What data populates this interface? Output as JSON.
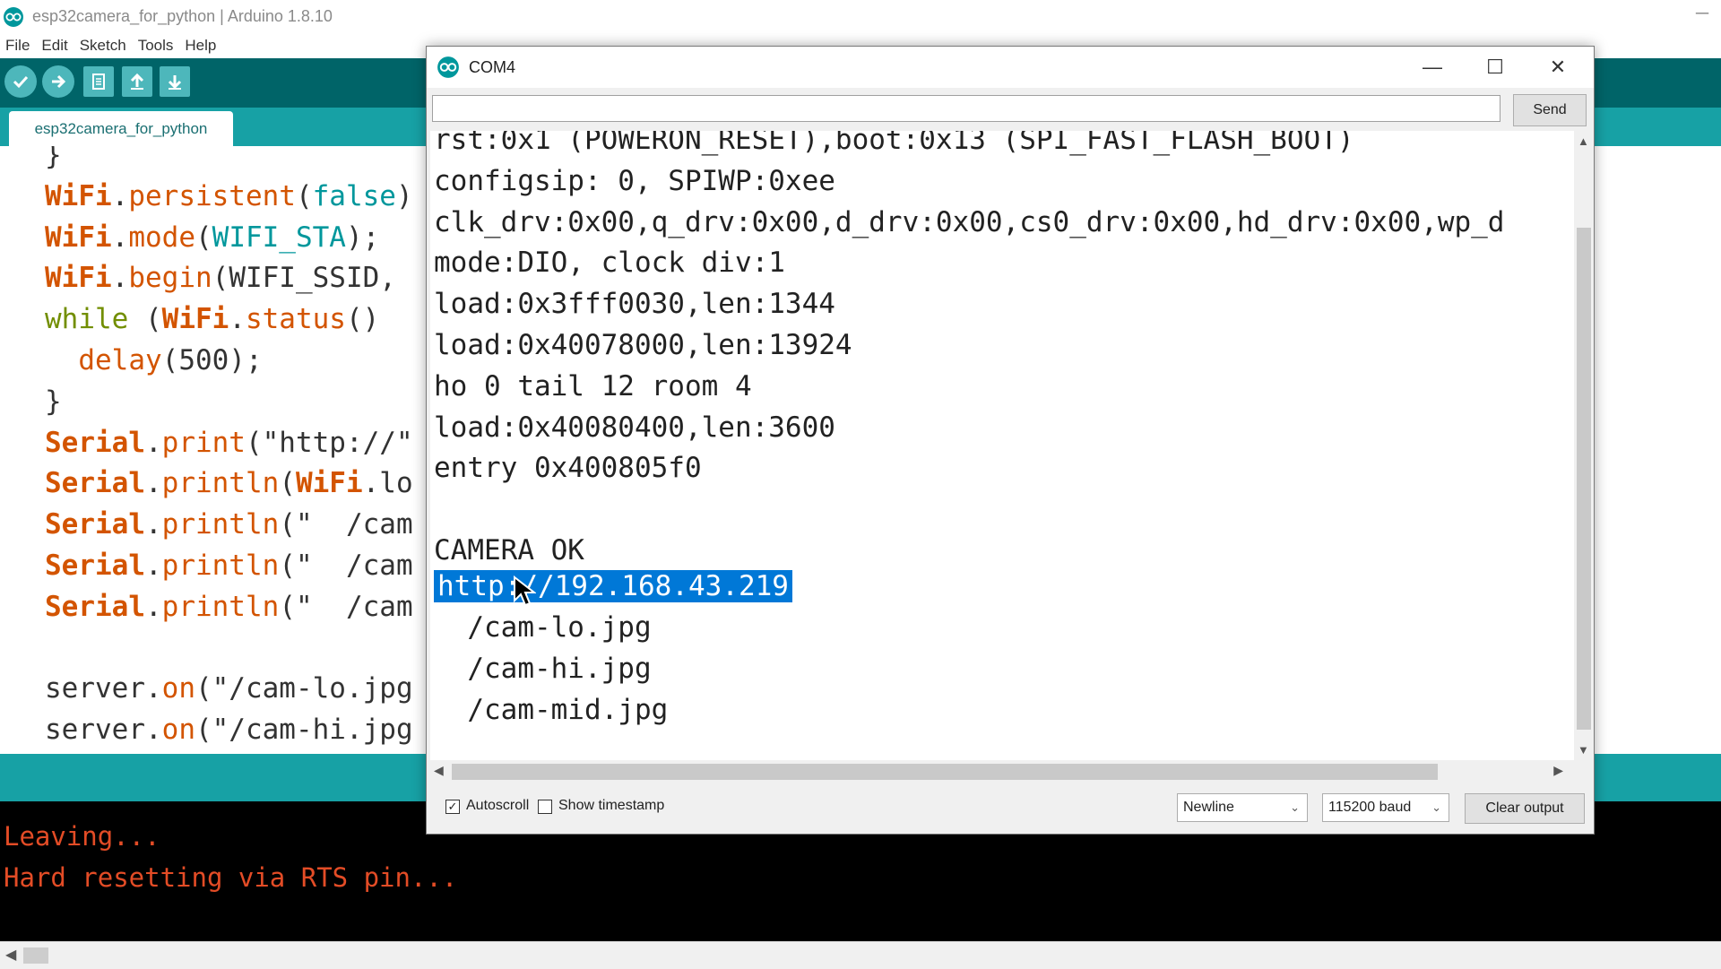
{
  "window": {
    "title": "esp32camera_for_python | Arduino 1.8.10",
    "minimize": "─"
  },
  "menu": [
    "File",
    "Edit",
    "Sketch",
    "Tools",
    "Help"
  ],
  "toolbar": {
    "buttons": [
      "verify-icon",
      "upload-icon",
      "new-icon",
      "open-icon",
      "save-icon"
    ]
  },
  "tab": {
    "label": "esp32camera_for_python"
  },
  "editor": {
    "lines": [
      [
        {
          "t": "}",
          "c": "plain"
        }
      ],
      [
        {
          "t": "WiFi",
          "c": "class"
        },
        {
          "t": ".",
          "c": "plain"
        },
        {
          "t": "persistent",
          "c": "fn"
        },
        {
          "t": "(",
          "c": "plain"
        },
        {
          "t": "false",
          "c": "const"
        },
        {
          "t": ")",
          "c": "plain"
        }
      ],
      [
        {
          "t": "WiFi",
          "c": "class"
        },
        {
          "t": ".",
          "c": "plain"
        },
        {
          "t": "mode",
          "c": "fn"
        },
        {
          "t": "(",
          "c": "plain"
        },
        {
          "t": "WIFI_STA",
          "c": "const"
        },
        {
          "t": ");",
          "c": "plain"
        }
      ],
      [
        {
          "t": "WiFi",
          "c": "class"
        },
        {
          "t": ".",
          "c": "plain"
        },
        {
          "t": "begin",
          "c": "fn"
        },
        {
          "t": "(WIFI_SSID,",
          "c": "plain"
        }
      ],
      [
        {
          "t": "while",
          "c": "ctrl"
        },
        {
          "t": " (",
          "c": "plain"
        },
        {
          "t": "WiFi",
          "c": "class"
        },
        {
          "t": ".",
          "c": "plain"
        },
        {
          "t": "status",
          "c": "fn"
        },
        {
          "t": "()",
          "c": "plain"
        }
      ],
      [
        {
          "t": "  ",
          "c": "plain"
        },
        {
          "t": "delay",
          "c": "fn"
        },
        {
          "t": "(500);",
          "c": "plain"
        }
      ],
      [
        {
          "t": "}",
          "c": "plain"
        }
      ],
      [
        {
          "t": "Serial",
          "c": "class"
        },
        {
          "t": ".",
          "c": "plain"
        },
        {
          "t": "print",
          "c": "fn"
        },
        {
          "t": "(\"http://\"",
          "c": "plain"
        }
      ],
      [
        {
          "t": "Serial",
          "c": "class"
        },
        {
          "t": ".",
          "c": "plain"
        },
        {
          "t": "println",
          "c": "fn"
        },
        {
          "t": "(",
          "c": "plain"
        },
        {
          "t": "WiFi",
          "c": "class"
        },
        {
          "t": ".lo",
          "c": "plain"
        }
      ],
      [
        {
          "t": "Serial",
          "c": "class"
        },
        {
          "t": ".",
          "c": "plain"
        },
        {
          "t": "println",
          "c": "fn"
        },
        {
          "t": "(\"  /cam",
          "c": "plain"
        }
      ],
      [
        {
          "t": "Serial",
          "c": "class"
        },
        {
          "t": ".",
          "c": "plain"
        },
        {
          "t": "println",
          "c": "fn"
        },
        {
          "t": "(\"  /cam",
          "c": "plain"
        }
      ],
      [
        {
          "t": "Serial",
          "c": "class"
        },
        {
          "t": ".",
          "c": "plain"
        },
        {
          "t": "println",
          "c": "fn"
        },
        {
          "t": "(\"  /cam",
          "c": "plain"
        }
      ],
      [
        {
          "t": "",
          "c": "plain"
        }
      ],
      [
        {
          "t": "server",
          "c": "plain"
        },
        {
          "t": ".",
          "c": "plain"
        },
        {
          "t": "on",
          "c": "fn"
        },
        {
          "t": "(\"/cam-lo.jpg",
          "c": "plain"
        }
      ],
      [
        {
          "t": "server",
          "c": "plain"
        },
        {
          "t": ".",
          "c": "plain"
        },
        {
          "t": "on",
          "c": "fn"
        },
        {
          "t": "(\"/cam-hi.jpg",
          "c": "plain"
        }
      ]
    ]
  },
  "console": {
    "lines": [
      "Leaving...",
      "Hard resetting via RTS pin..."
    ]
  },
  "serial_monitor": {
    "port": "COM4",
    "input_value": "",
    "send_label": "Send",
    "output_lines": [
      "rst:0x1 (POWERON_RESET),boot:0x13 (SPI_FAST_FLASH_BOOT)",
      "configsip: 0, SPIWP:0xee",
      "clk_drv:0x00,q_drv:0x00,d_drv:0x00,cs0_drv:0x00,hd_drv:0x00,wp_d",
      "mode:DIO, clock div:1",
      "load:0x3fff0030,len:1344",
      "load:0x40078000,len:13924",
      "ho 0 tail 12 room 4",
      "load:0x40080400,len:3600",
      "entry 0x400805f0",
      "",
      "CAMERA OK"
    ],
    "selected_line": "http://192.168.43.219",
    "url_lines": [
      "  /cam-lo.jpg",
      "  /cam-hi.jpg",
      "  /cam-mid.jpg"
    ],
    "autoscroll_label": "Autoscroll",
    "autoscroll_checked": true,
    "timestamp_label": "Show timestamp",
    "timestamp_checked": false,
    "line_ending": "Newline",
    "baud": "115200 baud",
    "clear_label": "Clear output"
  },
  "colors": {
    "toolbar": "#006468",
    "tabstrip": "#17a1a5",
    "class_keyword": "#d35400",
    "constant": "#00979c",
    "control": "#728e00",
    "console_text": "#e34c26",
    "selection": "#0078d7"
  }
}
